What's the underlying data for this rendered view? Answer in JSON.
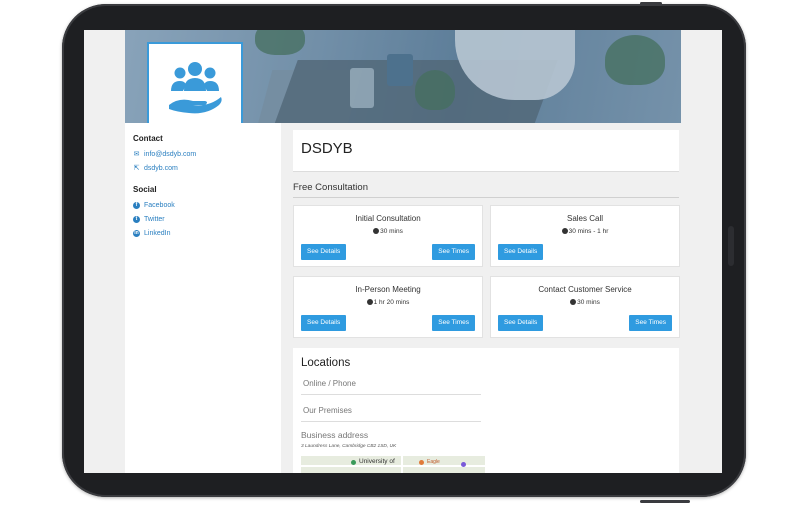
{
  "profile": {
    "logo_icon": "people-hand-icon",
    "accent_color": "#3a9ad9"
  },
  "sidebar": {
    "contact_heading": "Contact",
    "email": "info@dsdyb.com",
    "website": "dsdyb.com",
    "social_heading": "Social",
    "social_links": [
      {
        "label": "Facebook",
        "icon": "facebook-icon"
      },
      {
        "label": "Twitter",
        "icon": "twitter-icon"
      },
      {
        "label": "LinkedIn",
        "icon": "linkedin-icon"
      }
    ]
  },
  "main": {
    "business_name": "DSDYB",
    "section_title": "Free Consultation",
    "services": [
      {
        "name": "Initial Consultation",
        "duration": "30 mins",
        "details_label": "See Details",
        "times_label": "See Times"
      },
      {
        "name": "Sales Call",
        "duration": "30 mins - 1 hr",
        "details_label": "See Details"
      },
      {
        "name": "In-Person Meeting",
        "duration": "1 hr 20 mins",
        "details_label": "See Details",
        "times_label": "See Times"
      },
      {
        "name": "Contact Customer Service",
        "duration": "30 mins",
        "details_label": "See Details",
        "times_label": "See Times"
      }
    ],
    "locations": {
      "heading": "Locations",
      "items": [
        "Online / Phone",
        "Our Premises"
      ],
      "address_label": "Business address",
      "address": "3 Laundress Lane, Cambridge CB2 1SD, UK",
      "map_label_1": "University of",
      "map_label_2": "Eagle"
    }
  },
  "colors": {
    "button": "#2f9be0",
    "link": "#2a7fc0"
  }
}
